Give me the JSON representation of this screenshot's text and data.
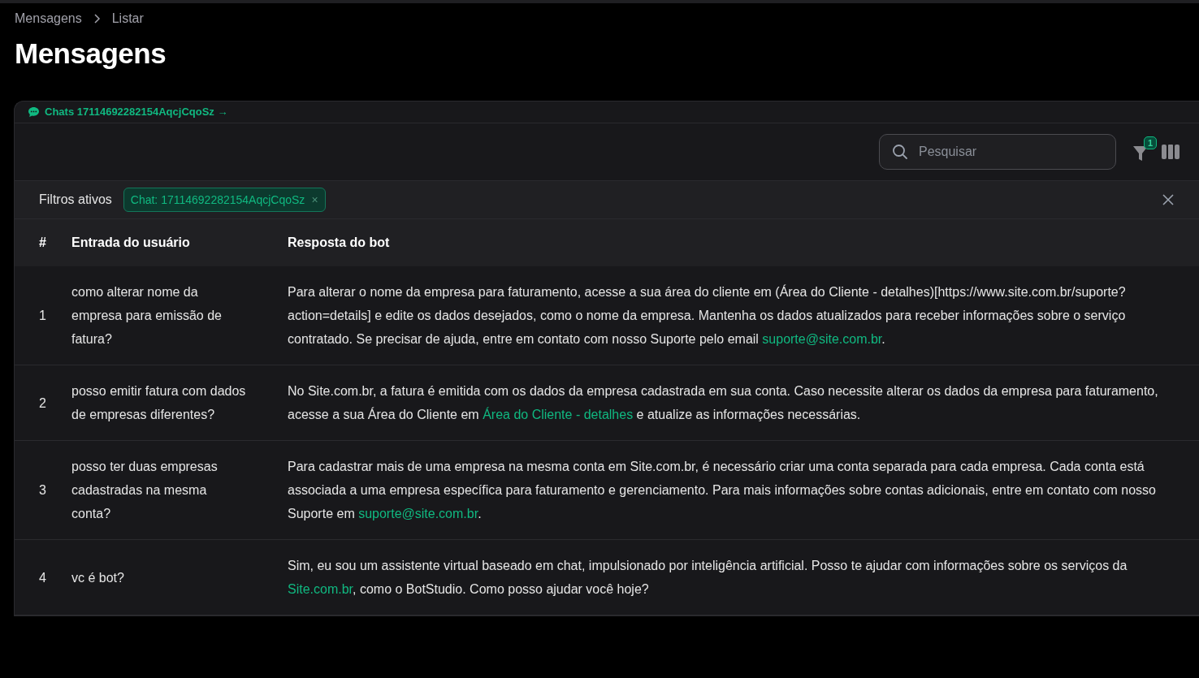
{
  "breadcrumbs": [
    {
      "label": "Mensagens"
    },
    {
      "label": "Listar"
    }
  ],
  "title": "Mensagens",
  "card_header": {
    "link": "Chats 17114692282154AqcjCqoSz →"
  },
  "toolbar": {
    "search": {
      "placeholder": "Pesquisar"
    },
    "filter_badge": "1"
  },
  "active_filters": {
    "label": "Filtros ativos",
    "chips": [
      {
        "label": "Chat: 17114692282154AqcjCqoSz",
        "remove": "×"
      }
    ]
  },
  "table": {
    "columns": [
      "#",
      "Entrada do usuário",
      "Resposta do bot"
    ],
    "rows": [
      {
        "index": "1",
        "input": "como alterar nome da empresa para emissão de fatura?",
        "response": [
          {
            "kind": "text",
            "text": "Para alterar o nome da empresa para faturamento, acesse a sua área do cliente em (Área do Cliente - detalhes)[https://www.site.com.br/suporte?action=details] e edite os dados desejados, como o nome da empresa. Mantenha os dados atualizados para receber informações sobre o serviço contratado. Se precisar de ajuda, entre em contato com nosso Suporte pelo email "
          },
          {
            "kind": "link",
            "text": "suporte@site.com.br"
          },
          {
            "kind": "text",
            "text": "."
          }
        ]
      },
      {
        "index": "2",
        "input": "posso emitir fatura com dados de empresas diferentes?",
        "response": [
          {
            "kind": "text",
            "text": "No Site.com.br, a fatura é emitida com os dados da empresa cadastrada em sua conta. Caso necessite alterar os dados da empresa para faturamento, acesse a sua Área do Cliente em "
          },
          {
            "kind": "link",
            "text": "Área do Cliente - detalhes"
          },
          {
            "kind": "text",
            "text": " e atualize as informações necessárias."
          }
        ]
      },
      {
        "index": "3",
        "input": "posso ter duas empresas cadastradas na mesma conta?",
        "response": [
          {
            "kind": "text",
            "text": "Para cadastrar mais de uma empresa na mesma conta em Site.com.br, é necessário criar uma conta separada para cada empresa. Cada conta está associada a uma empresa específica para faturamento e gerenciamento. Para mais informações sobre contas adicionais, entre em contato com nosso Suporte em "
          },
          {
            "kind": "link",
            "text": "suporte@site.com.br"
          },
          {
            "kind": "text",
            "text": "."
          }
        ]
      },
      {
        "index": "4",
        "input": "vc é bot?",
        "response": [
          {
            "kind": "text",
            "text": "Sim, eu sou um assistente virtual baseado em chat, impulsionado por inteligência artificial. Posso te ajudar com informações sobre os serviços da "
          },
          {
            "kind": "link",
            "text": "Site.com.br"
          },
          {
            "kind": "text",
            "text": ", como o BotStudio. Como posso ajudar você hoje?"
          }
        ]
      }
    ]
  }
}
